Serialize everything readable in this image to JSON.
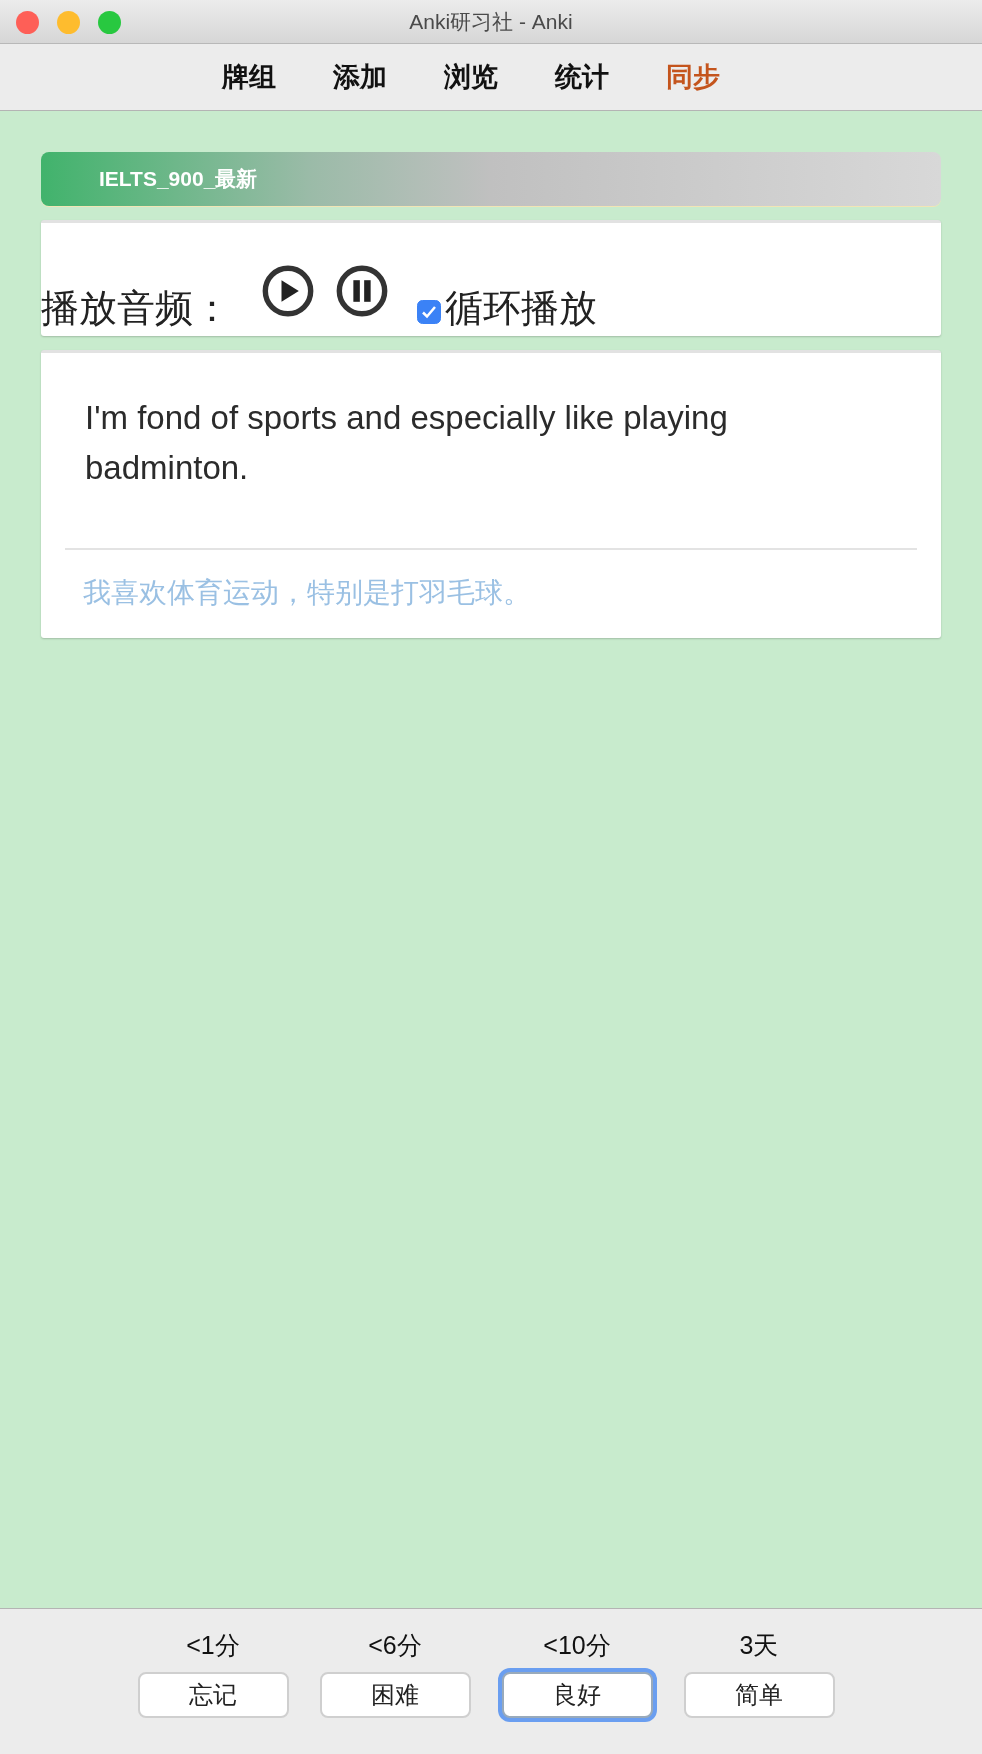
{
  "window": {
    "title": "Anki研习社 - Anki"
  },
  "toolbar": [
    {
      "label": "牌组",
      "highlighted": false
    },
    {
      "label": "添加",
      "highlighted": false
    },
    {
      "label": "浏览",
      "highlighted": false
    },
    {
      "label": "统计",
      "highlighted": false
    },
    {
      "label": "同步",
      "highlighted": true
    }
  ],
  "deck_bar": {
    "title": "IELTS_900_最新"
  },
  "audio": {
    "label": "播放音频：",
    "loop": {
      "label": "循环播放",
      "checked": true
    }
  },
  "card": {
    "sentence": "I'm fond of sports and especially like playing badminton.",
    "translation": "我喜欢体育运动，特别是打羽毛球。"
  },
  "answers": [
    {
      "interval": "<1分",
      "label": "忘记",
      "focused": false
    },
    {
      "interval": "<6分",
      "label": "困难",
      "focused": false
    },
    {
      "interval": "<10分",
      "label": "良好",
      "focused": true
    },
    {
      "interval": "3天",
      "label": "简单",
      "focused": false
    }
  ]
}
